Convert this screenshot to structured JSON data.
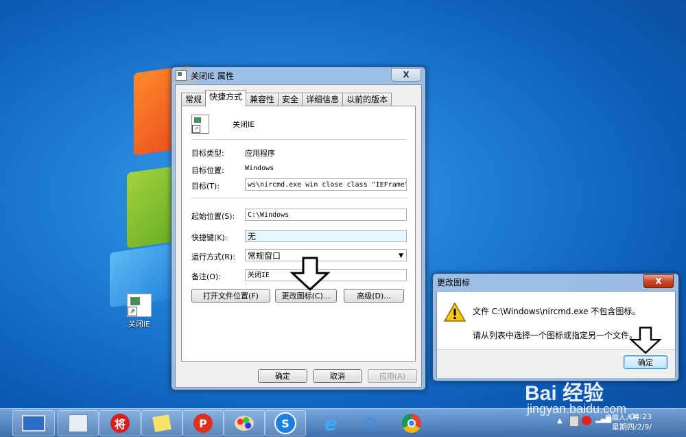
{
  "desktop": {
    "icon_label": "关闭IE"
  },
  "props": {
    "title": "关闭IE 属性",
    "close_label": "X",
    "tabs": [
      "常规",
      "快捷方式",
      "兼容性",
      "安全",
      "详细信息",
      "以前的版本"
    ],
    "name": "关闭IE",
    "target_type_label": "目标类型:",
    "target_type_value": "应用程序",
    "target_loc_label": "目标位置:",
    "target_loc_value": "Windows",
    "target_label": "目标(T):",
    "target_value": "ws\\nircmd.exe win close class \"IEFrame\"",
    "start_label": "起始位置(S):",
    "start_value": "C:\\Windows",
    "hotkey_label": "快捷键(K):",
    "hotkey_value": "无",
    "run_label": "运行方式(R):",
    "run_value": "常规窗口",
    "comment_label": "备注(O):",
    "comment_value": "关闭IE",
    "open_loc_btn": "打开文件位置(F)",
    "change_icon_btn": "更改图标(C)...",
    "advanced_btn": "高级(D)...",
    "ok_btn": "确定",
    "cancel_btn": "取消",
    "apply_btn": "应用(A)"
  },
  "change_icon": {
    "title": "更改图标",
    "close_label": "X",
    "message1": "文件 C:\\Windows\\nircmd.exe 不包含图标。",
    "message2": "请从列表中选择一个图标或指定另一个文件。",
    "ok_btn": "确定"
  },
  "taskbar": {
    "items": [
      "show-desktop",
      "explorer",
      "chess-app",
      "sticky-notes",
      "p-app",
      "paint",
      "s-app",
      "ie",
      "settings",
      "chrome"
    ],
    "chess_glyph": "将",
    "p_glyph": "P",
    "s_glyph": "S",
    "clock_line1": "04:23",
    "clock_line2": "星期四/2/9/",
    "tray_text": "电脑人人有"
  },
  "watermark": {
    "brand": "Bai 经验",
    "url": "jingyan.baidu.com"
  }
}
